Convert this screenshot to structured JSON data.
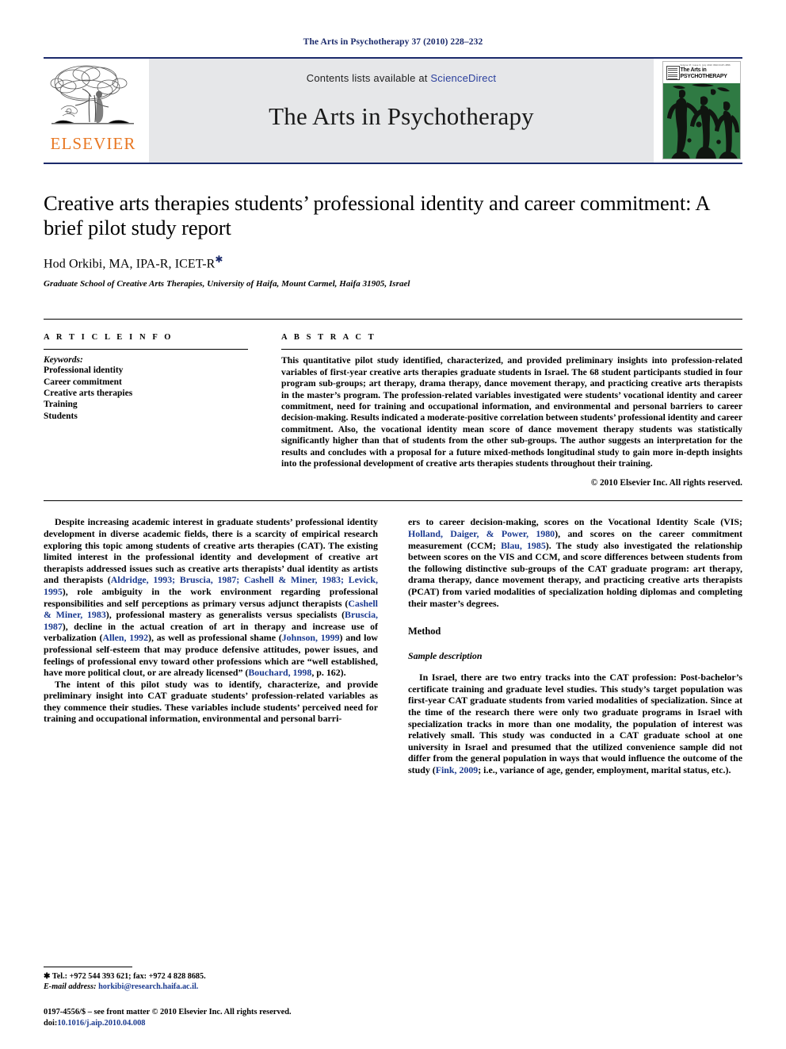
{
  "running_head": "The Arts in Psychotherapy 37 (2010) 228–232",
  "masthead": {
    "contents_prefix": "Contents lists available at ",
    "sciencedirect": "ScienceDirect",
    "journal_name": "The Arts in Psychotherapy",
    "publisher_logo_text": "ELSEVIER",
    "cover": {
      "top_line": "Volume 37, Issue 3, July 2010        ISSN 0197-4556",
      "title_line1": "The",
      "title_line2": "Arts in",
      "title_line3": "PSYCHOTHERAPY"
    }
  },
  "article": {
    "title": "Creative arts therapies students’ professional identity and career commitment: A brief pilot study report",
    "authors": "Hod Orkibi, MA, IPA-R, ICET-R",
    "author_footnote_marker": "✱",
    "affiliation": "Graduate School of Creative Arts Therapies, University of Haifa, Mount Carmel, Haifa 31905, Israel"
  },
  "article_info": {
    "label": "A R T I C L E   I N F O",
    "keywords_label": "Keywords:",
    "keywords": [
      "Professional identity",
      "Career commitment",
      "Creative arts therapies",
      "Training",
      "Students"
    ]
  },
  "abstract": {
    "label": "A B S T R A C T",
    "text": "This quantitative pilot study identified, characterized, and provided preliminary insights into profession-related variables of first-year creative arts therapies graduate students in Israel. The 68 student participants studied in four program sub-groups; art therapy, drama therapy, dance movement therapy, and practicing creative arts therapists in the master’s program. The profession-related variables investigated were students’ vocational identity and career commitment, need for training and occupational information, and environmental and personal barriers to career decision-making. Results indicated a moderate-positive correlation between students’ professional identity and career commitment. Also, the vocational identity mean score of dance movement therapy students was statistically significantly higher than that of students from the other sub-groups. The author suggests an interpretation for the results and concludes with a proposal for a future mixed-methods longitudinal study to gain more in-depth insights into the professional development of creative arts therapies students throughout their training.",
    "copyright": "© 2010 Elsevier Inc. All rights reserved."
  },
  "body": {
    "left_col": {
      "para1_a": "Despite increasing academic interest in graduate students’ professional identity development in diverse academic fields, there is a scarcity of empirical research exploring this topic among students of creative arts therapies (CAT). The existing limited interest in the professional identity and development of creative art therapists addressed issues such as creative arts therapists’ dual identity as artists and therapists (",
      "cite1": "Aldridge, 1993; Bruscia, 1987; Cashell & Miner, 1983; Levick, 1995",
      "para1_b": "), role ambiguity in the work environment regarding professional responsibilities and self perceptions as primary versus adjunct therapists (",
      "cite2": "Cashell & Miner, 1983",
      "para1_c": "), professional mastery as generalists versus specialists (",
      "cite3": "Bruscia, 1987",
      "para1_d": "), decline in the actual creation of art in therapy and increase use of verbalization (",
      "cite4": "Allen, 1992",
      "para1_e": "), as well as professional shame (",
      "cite5": "Johnson, 1999",
      "para1_f": ") and low professional self-esteem that may produce defensive attitudes, power issues, and feelings of professional envy toward other professions which are “well established, have more political clout, or are already licensed” (",
      "cite6": "Bouchard, 1998",
      "para1_g": ", p. 162).",
      "para2": "The intent of this pilot study was to identify, characterize, and provide preliminary insight into CAT graduate students’ profession-related variables as they commence their studies. These variables include students’ perceived need for training and occupational information, environmental and personal barri-"
    },
    "right_col": {
      "para1_a": "ers to career decision-making, scores on the Vocational Identity Scale (VIS; ",
      "cite1": "Holland, Daiger, & Power, 1980",
      "para1_b": "), and scores on the career commitment measurement (CCM; ",
      "cite2": "Blau, 1985",
      "para1_c": "). The study also investigated the relationship between scores on the VIS and CCM, and score differences between students from the following distinctive sub-groups of the CAT graduate program: art therapy, drama therapy, dance movement therapy, and practicing creative arts therapists (PCAT) from varied modalities of specialization holding diplomas and completing their master’s degrees.",
      "method_heading": "Method",
      "sample_heading": "Sample description",
      "para2_a": "In Israel, there are two entry tracks into the CAT profession: Post-bachelor’s certificate training and graduate level studies. This study’s target population was first-year CAT graduate students from varied modalities of specialization. Since at the time of the research there were only two graduate programs in Israel with specialization tracks in more than one modality, the population of interest was relatively small. This study was conducted in a CAT graduate school at one university in Israel and presumed that the utilized convenience sample did not differ from the general population in ways that would influence the outcome of the study (",
      "cite3": "Fink, 2009",
      "para2_b": "; i.e., variance of age, gender, employment, marital status, etc.)."
    }
  },
  "footnotes": {
    "tel_line": "✱ Tel.: +972 544 393 621; fax: +972 4 828 8685.",
    "email_label": "E-mail address:",
    "email": "horkibi@research.haifa.ac.il."
  },
  "imprint": {
    "line1": "0197-4556/$ – see front matter © 2010 Elsevier Inc. All rights reserved.",
    "doi_label": "doi:",
    "doi": "10.1016/j.aip.2010.04.008"
  },
  "colors": {
    "running_head": "#1b2a6b",
    "rule": "#1b2a6b",
    "elsevier_orange": "#e87722",
    "citation_blue": "#1b3a8f",
    "banner_grey": "#e6e7e9",
    "cover_green": "#2f7a43"
  }
}
